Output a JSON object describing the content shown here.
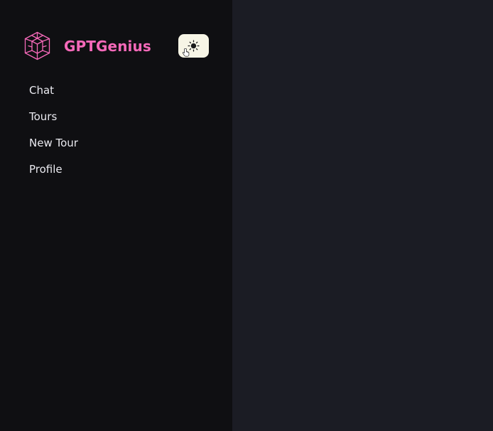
{
  "brand": {
    "name": "GPTGenius",
    "icon": "hexagon-cube-logo-icon"
  },
  "theme_toggle": {
    "icon": "sun-icon"
  },
  "nav": {
    "items": [
      {
        "label": "Chat"
      },
      {
        "label": "Tours"
      },
      {
        "label": "New Tour"
      },
      {
        "label": "Profile"
      }
    ]
  },
  "colors": {
    "accent": "#f569b9",
    "sidebar_bg": "#0f0f12",
    "main_bg": "#1b1c24",
    "nav_text": "#eaeaf0",
    "toggle_bg": "#f7f5e6"
  }
}
